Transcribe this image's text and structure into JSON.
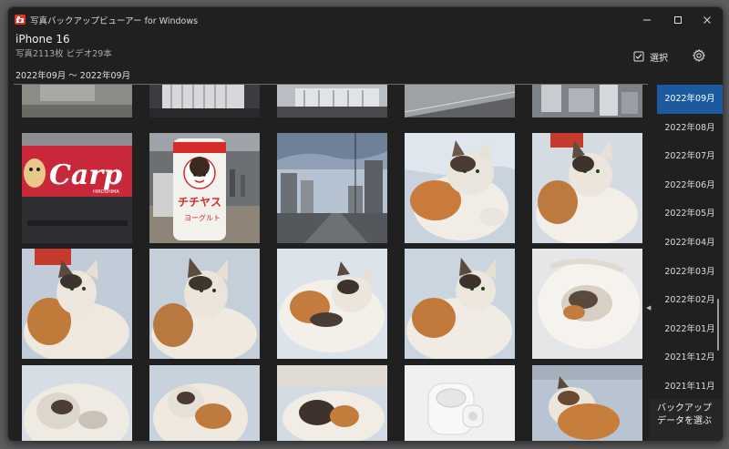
{
  "window": {
    "title": "写真バックアップビューアー for Windows",
    "app_icon": "photo-app-icon",
    "controls": [
      "minimize-icon",
      "maximize-icon",
      "close-icon"
    ]
  },
  "header": {
    "device_name": "iPhone 16",
    "stats": "写真2113枚 ビデオ29本",
    "date_range": "2022年09月 〜 2022年09月",
    "select_label": "選択",
    "select_icon": "checkbox-icon",
    "settings_icon": "gear-icon"
  },
  "months": [
    {
      "label": "2022年09月",
      "selected": true
    },
    {
      "label": "2022年08月",
      "selected": false
    },
    {
      "label": "2022年07月",
      "selected": false
    },
    {
      "label": "2022年06月",
      "selected": false
    },
    {
      "label": "2022年05月",
      "selected": false
    },
    {
      "label": "2022年04月",
      "selected": false
    },
    {
      "label": "2022年03月",
      "selected": false
    },
    {
      "label": "2022年02月",
      "selected": false
    },
    {
      "label": "2022年01月",
      "selected": false
    },
    {
      "label": "2021年12月",
      "selected": false
    },
    {
      "label": "2021年11月",
      "selected": false
    }
  ],
  "photo_sign": {
    "brand": "Carp",
    "sub": "HIROSHIMA"
  },
  "photo_bottle": {
    "line1": "チチヤス",
    "line2": "ヨーグルト"
  },
  "backup_button": {
    "label": "バックアップデータを選ぶ"
  },
  "colors": {
    "accent": "#1c5aa0",
    "background": "#202020"
  }
}
